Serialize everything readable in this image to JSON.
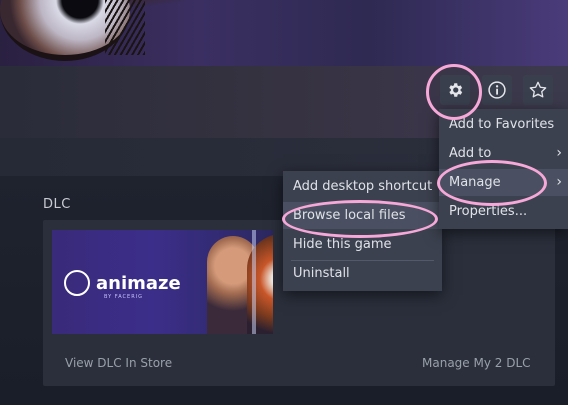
{
  "toolbar": {
    "settings_icon": "gear-icon",
    "info_icon": "info-icon",
    "favorite_icon": "star-icon"
  },
  "dlc": {
    "section_title": "DLC",
    "image_brand": "animaze",
    "image_sub": "BY FACERIG",
    "view_store_label": "View DLC In Store",
    "manage_label": "Manage My 2 DLC"
  },
  "context_menu": {
    "items": [
      {
        "label": "Add to Favorites"
      },
      {
        "label": "Add to",
        "submenu": true
      },
      {
        "label": "Manage",
        "submenu": true
      },
      {
        "label": "Properties..."
      }
    ]
  },
  "manage_submenu": {
    "items": [
      {
        "label": "Add desktop shortcut"
      },
      {
        "label": "Browse local files"
      },
      {
        "label": "Hide this game"
      },
      {
        "label": "Uninstall"
      }
    ]
  },
  "colors": {
    "annotation_ring": "#f6a8d8",
    "menu_bg": "#3c414f"
  }
}
